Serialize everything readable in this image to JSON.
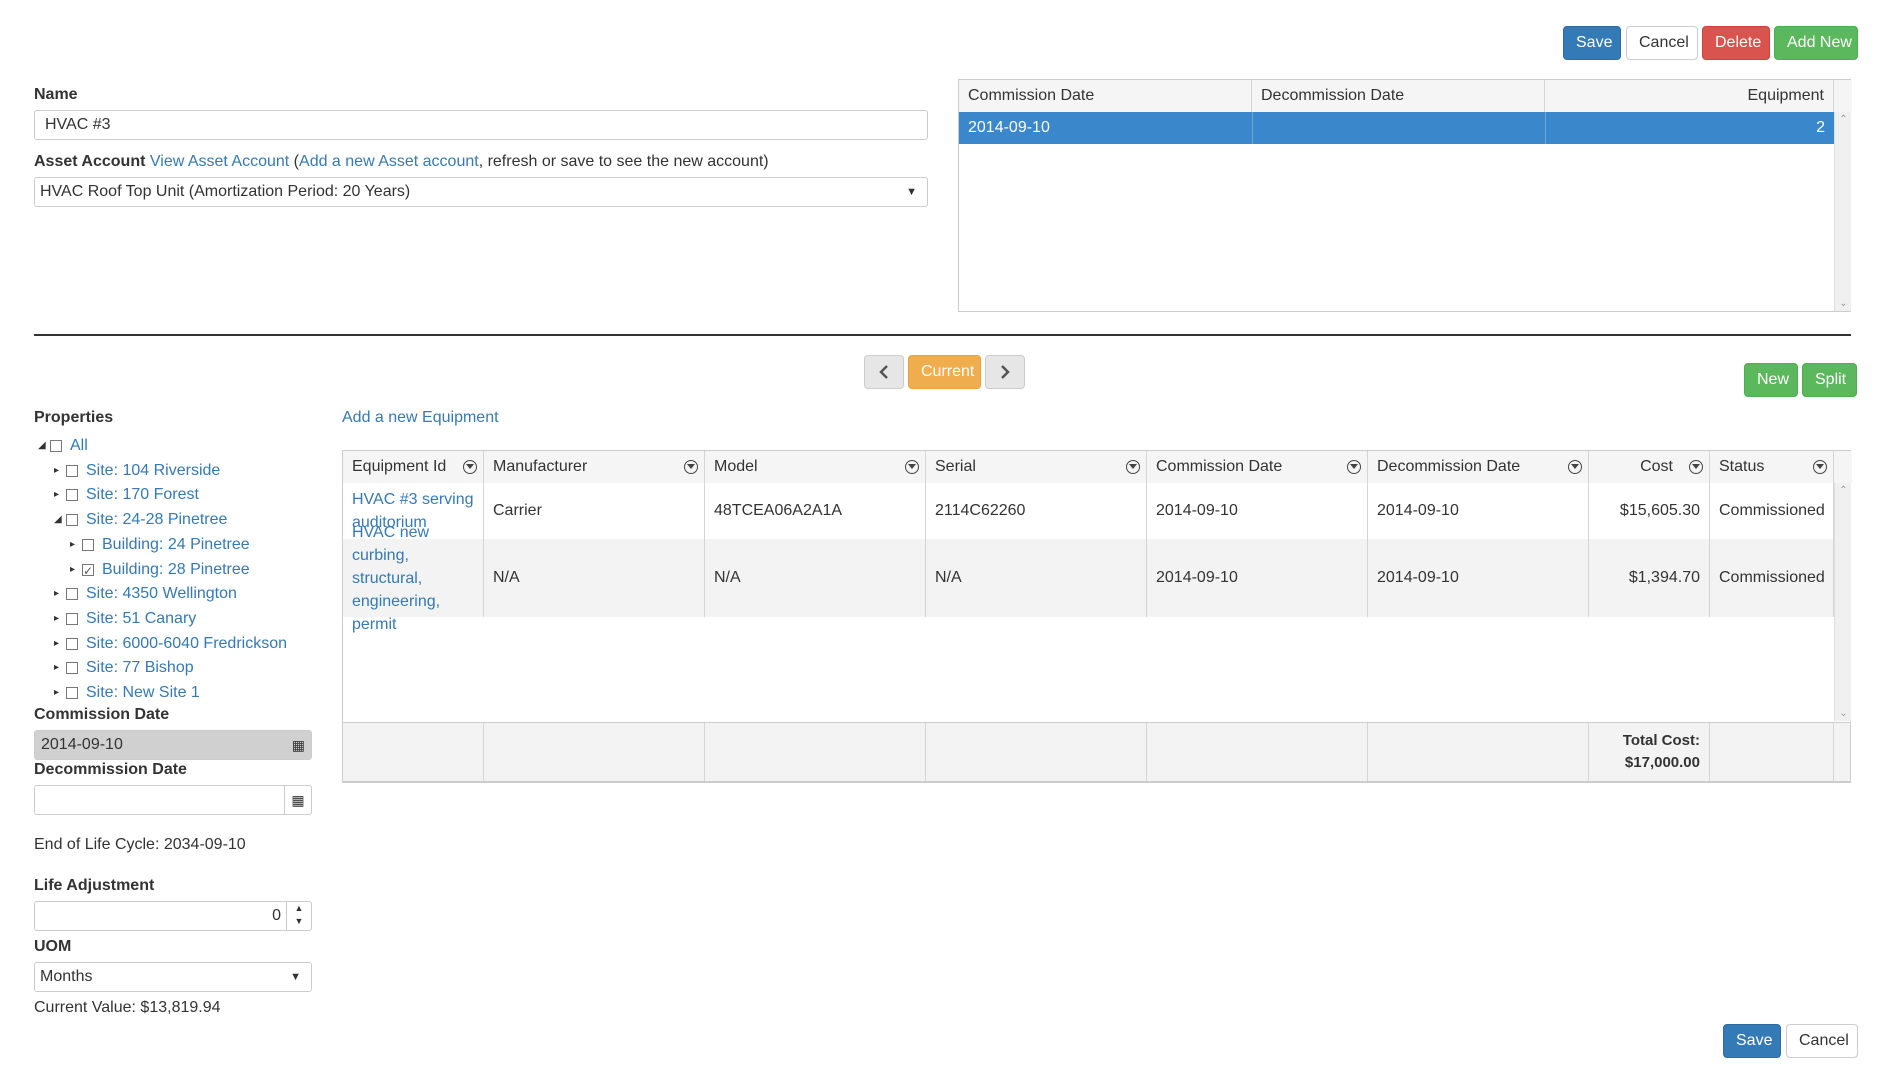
{
  "toolbar": {
    "save": "Save",
    "cancel": "Cancel",
    "delete": "Delete",
    "add_new": "Add New"
  },
  "form": {
    "name_label": "Name",
    "name_value": "HVAC #3",
    "asset_account_label": "Asset Account",
    "view_asset_account": "View Asset Account",
    "paren_open": " (",
    "add_asset_account": "Add a new Asset account",
    "refresh_note": ", refresh or save to see the new account)",
    "asset_account_value": "HVAC Roof Top Unit (Amortization Period: 20 Years)"
  },
  "commission_grid": {
    "headers": [
      "Commission Date",
      "Decommission Date",
      "Equipment"
    ],
    "rows": [
      {
        "commission_date": "2014-09-10",
        "decommission_date": "",
        "equipment": "2"
      }
    ]
  },
  "nav": {
    "current": "Current",
    "new": "New",
    "split": "Split",
    "prev_icon": "chevron-left-icon",
    "next_icon": "chevron-right-icon"
  },
  "properties": {
    "label": "Properties",
    "tree": [
      {
        "label": "All",
        "level": 0,
        "expanded": true,
        "checked": false
      },
      {
        "label": "Site: 104 Riverside",
        "level": 1,
        "expanded": false,
        "checked": false
      },
      {
        "label": "Site: 170 Forest",
        "level": 1,
        "expanded": false,
        "checked": false
      },
      {
        "label": "Site: 24-28 Pinetree",
        "level": 1,
        "expanded": true,
        "checked": false
      },
      {
        "label": "Building: 24 Pinetree",
        "level": 2,
        "expanded": false,
        "checked": false
      },
      {
        "label": "Building: 28 Pinetree",
        "level": 2,
        "expanded": false,
        "checked": true
      },
      {
        "label": "Site: 4350 Wellington",
        "level": 1,
        "expanded": false,
        "checked": false
      },
      {
        "label": "Site: 51 Canary",
        "level": 1,
        "expanded": false,
        "checked": false
      },
      {
        "label": "Site: 6000-6040 Fredrickson",
        "level": 1,
        "expanded": false,
        "checked": false
      },
      {
        "label": "Site: 77 Bishop",
        "level": 1,
        "expanded": false,
        "checked": false
      },
      {
        "label": "Site: New Site 1",
        "level": 1,
        "expanded": false,
        "checked": false
      }
    ]
  },
  "details": {
    "commission_date_label": "Commission Date",
    "commission_date_value": "2014-09-10",
    "decommission_date_label": "Decommission Date",
    "decommission_date_value": "",
    "end_of_life": "End of Life Cycle: 2034-09-10",
    "life_adjustment_label": "Life Adjustment",
    "life_adjustment_value": "0",
    "uom_label": "UOM",
    "uom_value": "Months",
    "current_value": "Current Value: $13,819.94"
  },
  "equipment": {
    "add_link": "Add a new Equipment",
    "headers": [
      "Equipment Id",
      "Manufacturer",
      "Model",
      "Serial",
      "Commission Date",
      "Decommission Date",
      "Cost",
      "Status"
    ],
    "rows": [
      {
        "id_lines": [
          "HVAC #3 serving",
          "auditorium"
        ],
        "manufacturer": "Carrier",
        "model": "48TCEA06A2A1A",
        "serial": "2114C62260",
        "commission_date": "2014-09-10",
        "decommission_date": "2014-09-10",
        "cost": "$15,605.30",
        "status": "Commissioned"
      },
      {
        "id_lines": [
          "HVAC new curbing,",
          "structural,",
          "engineering, permit"
        ],
        "manufacturer": "N/A",
        "model": "N/A",
        "serial": "N/A",
        "commission_date": "2014-09-10",
        "decommission_date": "2014-09-10",
        "cost": "$1,394.70",
        "status": "Commissioned"
      }
    ],
    "total_label": "Total Cost:",
    "total_value": "$17,000.00"
  },
  "footer": {
    "save": "Save",
    "cancel": "Cancel"
  },
  "colors": {
    "primary": "#337ab7",
    "danger": "#d9534f",
    "success": "#5cb85c",
    "warning": "#f0ad4e",
    "selected_row": "#3a87cc"
  }
}
